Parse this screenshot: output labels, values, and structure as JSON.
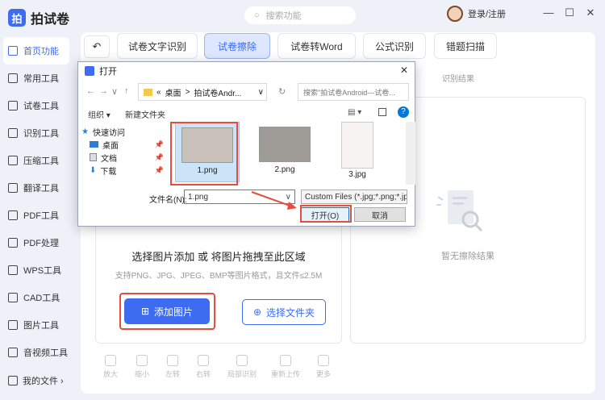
{
  "app": {
    "title": "拍试卷",
    "search_placeholder": "搜索功能",
    "login": "登录/注册"
  },
  "window_controls": {
    "min": "—",
    "max": "☐",
    "close": "✕"
  },
  "sidebar": {
    "items": [
      {
        "label": "首页功能",
        "active": true
      },
      {
        "label": "常用工具"
      },
      {
        "label": "试卷工具"
      },
      {
        "label": "识别工具"
      },
      {
        "label": "压缩工具"
      },
      {
        "label": "翻译工具"
      },
      {
        "label": "PDF工具"
      },
      {
        "label": "PDF处理"
      },
      {
        "label": "WPS工具"
      },
      {
        "label": "CAD工具"
      },
      {
        "label": "图片工具"
      },
      {
        "label": "音视频工具"
      }
    ],
    "footer": "我的文件 ›"
  },
  "tabs": [
    {
      "label": "试卷文字识别"
    },
    {
      "label": "试卷擦除",
      "active": true
    },
    {
      "label": "试卷转Word"
    },
    {
      "label": "公式识别"
    },
    {
      "label": "错题扫描"
    }
  ],
  "main": {
    "back": "↶",
    "result_title": "识别结果",
    "empty_text": "暂无擦除结果",
    "drop_title": "选择图片添加 或 将图片拖拽至此区域",
    "drop_sub": "支持PNG、JPG、JPEG、BMP等图片格式，且文件≤2.5M",
    "add_button": "添加图片",
    "folder_button": "选择文件夹"
  },
  "bottom_tools": [
    {
      "label": "放大"
    },
    {
      "label": "缩小"
    },
    {
      "label": "左转"
    },
    {
      "label": "右转"
    },
    {
      "label": "局部识别"
    },
    {
      "label": "重新上传"
    },
    {
      "label": "更多"
    }
  ],
  "dialog": {
    "title": "打开",
    "close": "✕",
    "nav": {
      "back": "←",
      "forward": "→",
      "dropdown": "∨",
      "up": "↑",
      "refresh": "↻"
    },
    "path": {
      "prefix": "«",
      "part1": "桌面",
      "sep": ">",
      "part2": "拍试卷Andr...",
      "dropdown": "∨"
    },
    "search_placeholder": "搜索\"拍试卷Android---试卷...",
    "organize": "组织 ▾",
    "new_folder": "新建文件夹",
    "view_icon": "▤ ▾",
    "help": "?",
    "tree": [
      {
        "label": "快速访问",
        "pin": ""
      },
      {
        "label": "桌面",
        "pin": "📌"
      },
      {
        "label": "文档",
        "pin": "📌"
      },
      {
        "label": "下载",
        "pin": "📌"
      }
    ],
    "files": [
      {
        "name": "1.png",
        "selected": true
      },
      {
        "name": "2.png"
      },
      {
        "name": "3.jpg"
      }
    ],
    "filename_label": "文件名(N):",
    "filename_value": "1.png",
    "filter_value": "Custom Files (*.jpg;*.png;*.jp",
    "ok": "打开(O)",
    "cancel": "取消"
  }
}
